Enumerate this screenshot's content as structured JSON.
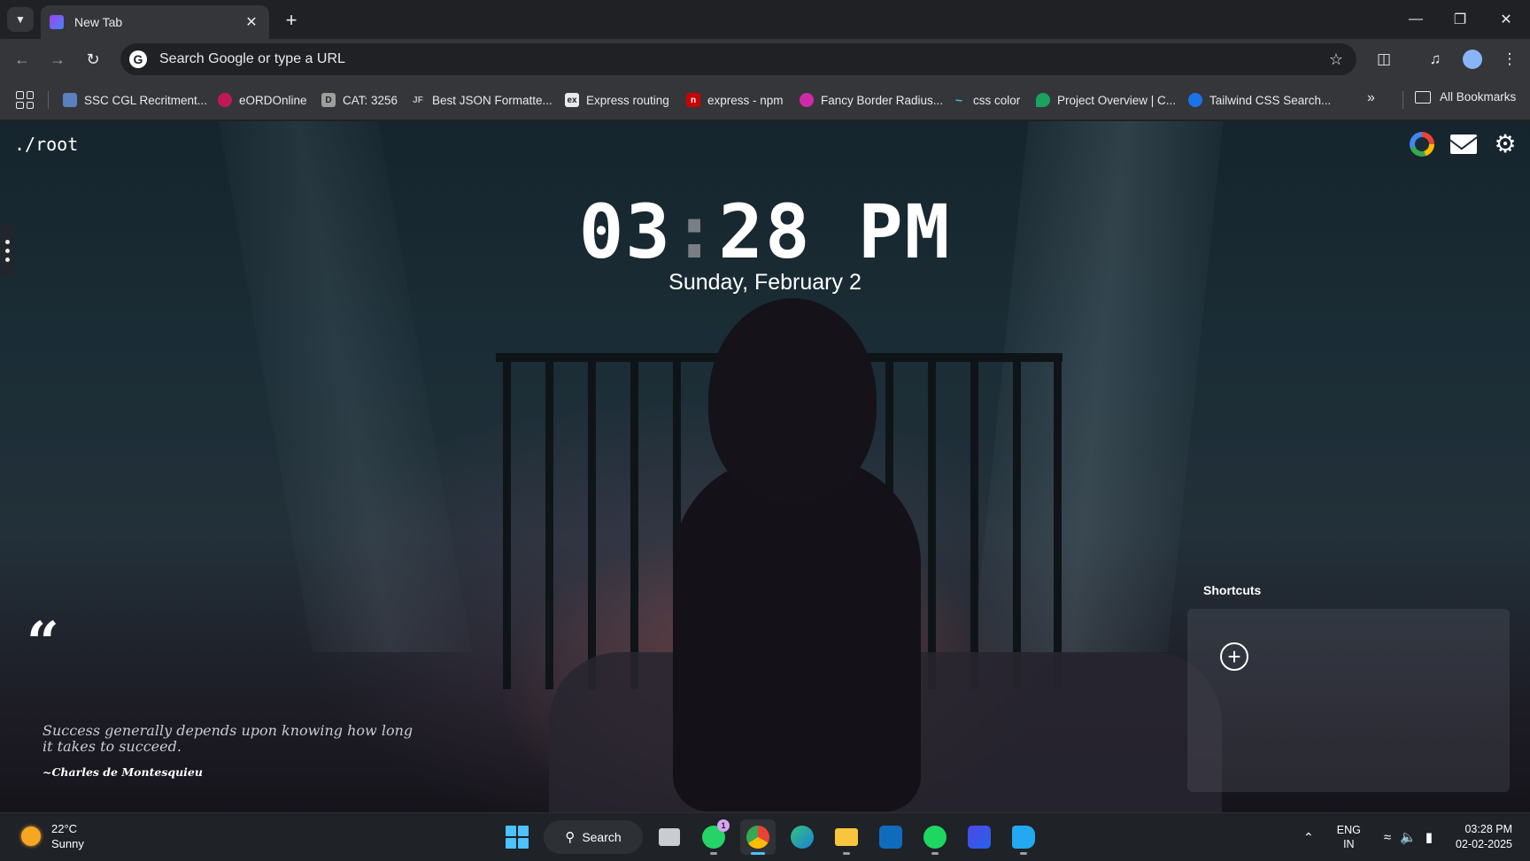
{
  "browser": {
    "tab": {
      "title": "New Tab"
    },
    "omnibox": {
      "placeholder": "Search Google or type a URL"
    },
    "bookmarks": [
      {
        "label": "SSC CGL Recritment...",
        "icon_color": "#5b7fbf",
        "icon_text": ""
      },
      {
        "label": "eORDOnline",
        "icon_color": "#c2185b",
        "icon_text": ""
      },
      {
        "label": "CAT: 3256",
        "icon_color": "#9e9e9e",
        "icon_text": "D"
      },
      {
        "label": "Best JSON Formatte...",
        "icon_color": "#35363a",
        "icon_text": "JF"
      },
      {
        "label": "Express routing",
        "icon_color": "#e8eaed",
        "icon_text": "ex"
      },
      {
        "label": "express - npm",
        "icon_color": "#cb0000",
        "icon_text": "n"
      },
      {
        "label": "Fancy Border Radius...",
        "icon_color": "#d02aa8",
        "icon_text": ""
      },
      {
        "label": "css color",
        "icon_color": "#38bdf8",
        "icon_text": "~"
      },
      {
        "label": "Project Overview | C...",
        "icon_color": "#1aa260",
        "icon_text": ""
      },
      {
        "label": "Tailwind CSS Search...",
        "icon_color": "#1a73e8",
        "icon_text": ""
      }
    ],
    "all_bookmarks_label": "All Bookmarks"
  },
  "page": {
    "brand": "./root",
    "clock": {
      "hours": "03",
      "separator": ":",
      "minutes": "28",
      "meridiem": "PM"
    },
    "date": "Sunday, February 2",
    "quote": {
      "mark": "“",
      "text": "Success generally depends upon knowing how long it takes to succeed.",
      "author": "~Charles de Montesquieu"
    },
    "shortcuts": {
      "title": "Shortcuts",
      "add_symbol": "+"
    }
  },
  "taskbar": {
    "weather": {
      "temp": "22°C",
      "condition": "Sunny"
    },
    "search_label": "Search",
    "whatsapp_badge": "1",
    "language": {
      "line1": "ENG",
      "line2": "IN"
    },
    "time": "03:28 PM",
    "date": "02-02-2025"
  }
}
